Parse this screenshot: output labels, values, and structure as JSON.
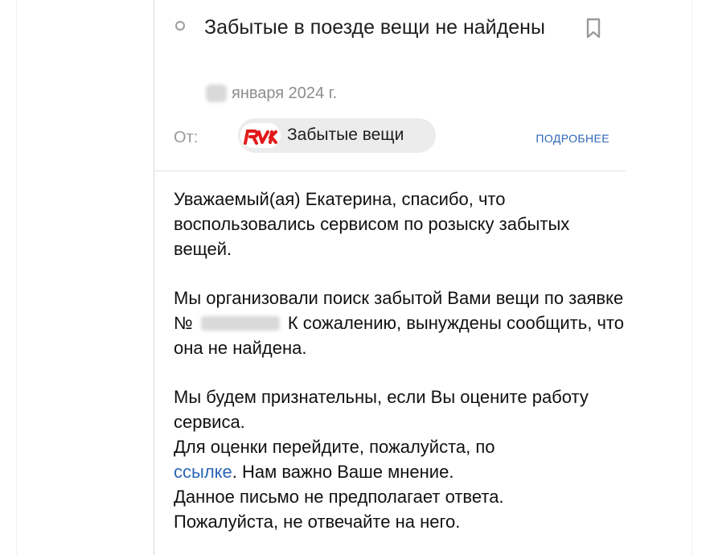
{
  "header": {
    "subject": "Забытые в поезде вещи не найдены",
    "date": "января 2024 г.",
    "from_label": "От:",
    "sender_name": "Забытые вещи",
    "details_label": "ПОДРОБНЕЕ",
    "logo_text": "РЖД"
  },
  "body": {
    "paragraph1": "Уважаемый(ая) Екатерина, спасибо, что воспользовались сервисом по розыску забытых вещей.",
    "paragraph2_part1": "Мы организовали поиск забытой Вами вещи по заявке №",
    "paragraph2_part2": "К сожалению, вынуждены сообщить, что она не найдена.",
    "paragraph3_line1": "Мы будем признательны, если Вы оцените работу сервиса.",
    "paragraph3_line2": "Для оценки перейдите, пожалуйста, по",
    "link_text": "ссылке",
    "paragraph3_after_link": ". Нам важно Ваше мнение.",
    "paragraph3_line4": "Данное письмо не предполагает ответа.",
    "paragraph3_line5": "Пожалуйста, не отвечайте на него."
  },
  "colors": {
    "link": "#2c66b5",
    "logo_red": "#e21a1a",
    "chip_bg": "#ececec",
    "muted_text": "#8d8d8d"
  },
  "icons": {
    "unread": "radio-circle-icon",
    "bookmark": "bookmark-icon",
    "sender_logo": "rzd-logo"
  }
}
